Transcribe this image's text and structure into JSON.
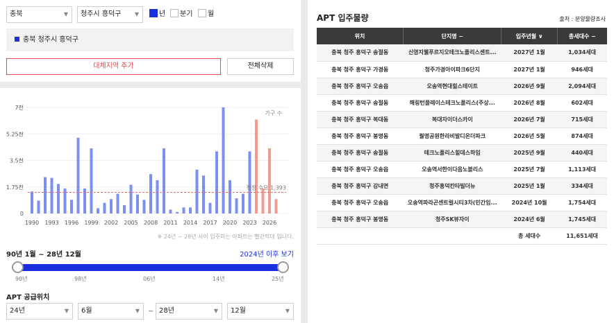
{
  "filters": {
    "province": "충북",
    "district": "청주시 흥덕구",
    "period_options": [
      {
        "label": "년",
        "checked": true
      },
      {
        "label": "분기",
        "checked": false
      },
      {
        "label": "월",
        "checked": false
      }
    ]
  },
  "region_selected": "충북 청주시 흥덕구",
  "buttons": {
    "add_region": "대체지역 추가",
    "delete_all": "전체삭제"
  },
  "colors": {
    "accent": "#1a2fe0",
    "bar_past": "#7d8ff0",
    "bar_future": "#f29a8e",
    "demand_line": "#e46b6b",
    "add_button": "#e04b4b"
  },
  "chart_data": {
    "type": "bar",
    "x": [
      1990,
      1991,
      1992,
      1993,
      1994,
      1995,
      1996,
      1997,
      1998,
      1999,
      2000,
      2001,
      2002,
      2003,
      2004,
      2005,
      2006,
      2007,
      2008,
      2009,
      2010,
      2011,
      2012,
      2013,
      2014,
      2015,
      2016,
      2017,
      2018,
      2019,
      2020,
      2021,
      2022,
      2023,
      2024,
      2025,
      2026,
      2027
    ],
    "values": [
      1450,
      850,
      2400,
      2350,
      1950,
      1650,
      900,
      5000,
      1650,
      4300,
      350,
      700,
      950,
      1300,
      550,
      1900,
      1250,
      900,
      2600,
      2200,
      4300,
      250,
      100,
      400,
      400,
      2900,
      2500,
      700,
      4100,
      7000,
      2200,
      1000,
      1300,
      4100,
      6200,
      1650,
      4300,
      950
    ],
    "future_from": 2024,
    "xticks": [
      "1990",
      "1993",
      "1996",
      "1999",
      "2002",
      "2005",
      "2008",
      "2011",
      "2014",
      "2017",
      "2020",
      "2023",
      "2026"
    ],
    "yticks": [
      "0",
      "1.75천",
      "3.5천",
      "5.25천",
      "7천"
    ],
    "ylim": [
      0,
      7000
    ],
    "legend": "가구 수",
    "demand_label": "적정 수요 1,393",
    "demand_value": 1393
  },
  "chart_note": "※ 24년 ~ 28년 사이 입주하는 아파트는 빨간막대 입니다.",
  "range": {
    "label": "90년 1월 ~ 28년 12월",
    "link": "2024년 이후 보기",
    "ticks": [
      "90년",
      "98년",
      "06년",
      "14년",
      "25년"
    ]
  },
  "supply": {
    "title": "APT 공급위치",
    "from_year": "24년",
    "from_month": "6월",
    "to_year": "28년",
    "to_month": "12월"
  },
  "apt": {
    "title": "APT 입주물량",
    "source": "출처 : 분양물량조사",
    "headers": [
      "위치",
      "단지명 −",
      "입주년월 ∨",
      "총세대수 −"
    ],
    "rows": [
      [
        "충북 청주 흥덕구 송절동",
        "신영지웰푸르지오테크노폴리스센트...",
        "2027년 1월",
        "1,034세대"
      ],
      [
        "충북 청주 흥덕구 가경동",
        "청주가경아이파크6단지",
        "2027년 1월",
        "946세대"
      ],
      [
        "충북 청주 흥덕구 오송읍",
        "오송역현대힐스테이트",
        "2026년 9월",
        "2,094세대"
      ],
      [
        "충북 청주 흥덕구 송절동",
        "해링턴플레이스테크노폴리스(주상...",
        "2026년 8월",
        "602세대"
      ],
      [
        "충북 청주 흥덕구 복대동",
        "복대자이더스카이",
        "2026년 7월",
        "715세대"
      ],
      [
        "충북 청주 흥덕구 봉명동",
        "월명공원한라비발디온더파크",
        "2026년 5월",
        "874세대"
      ],
      [
        "충북 청주 흥덕구 송절동",
        "테크노폴리스힐데스하임",
        "2025년 9월",
        "440세대"
      ],
      [
        "충북 청주 흥덕구 오송읍",
        "오송역서한이다음노블리스",
        "2025년 7월",
        "1,113세대"
      ],
      [
        "충북 청주 흥덕구 강내면",
        "청주흥덕칸타빌더뉴",
        "2025년 1월",
        "334세대"
      ],
      [
        "충북 청주 흥덕구 오송읍",
        "오송역파라곤센트럴시티3차(민간임...",
        "2024년 10월",
        "1,754세대"
      ],
      [
        "충북 청주 흥덕구 봉명동",
        "청주SK뷰자이",
        "2024년 6월",
        "1,745세대"
      ]
    ],
    "total_label": "총 세대수",
    "total_value": "11,651세대"
  }
}
